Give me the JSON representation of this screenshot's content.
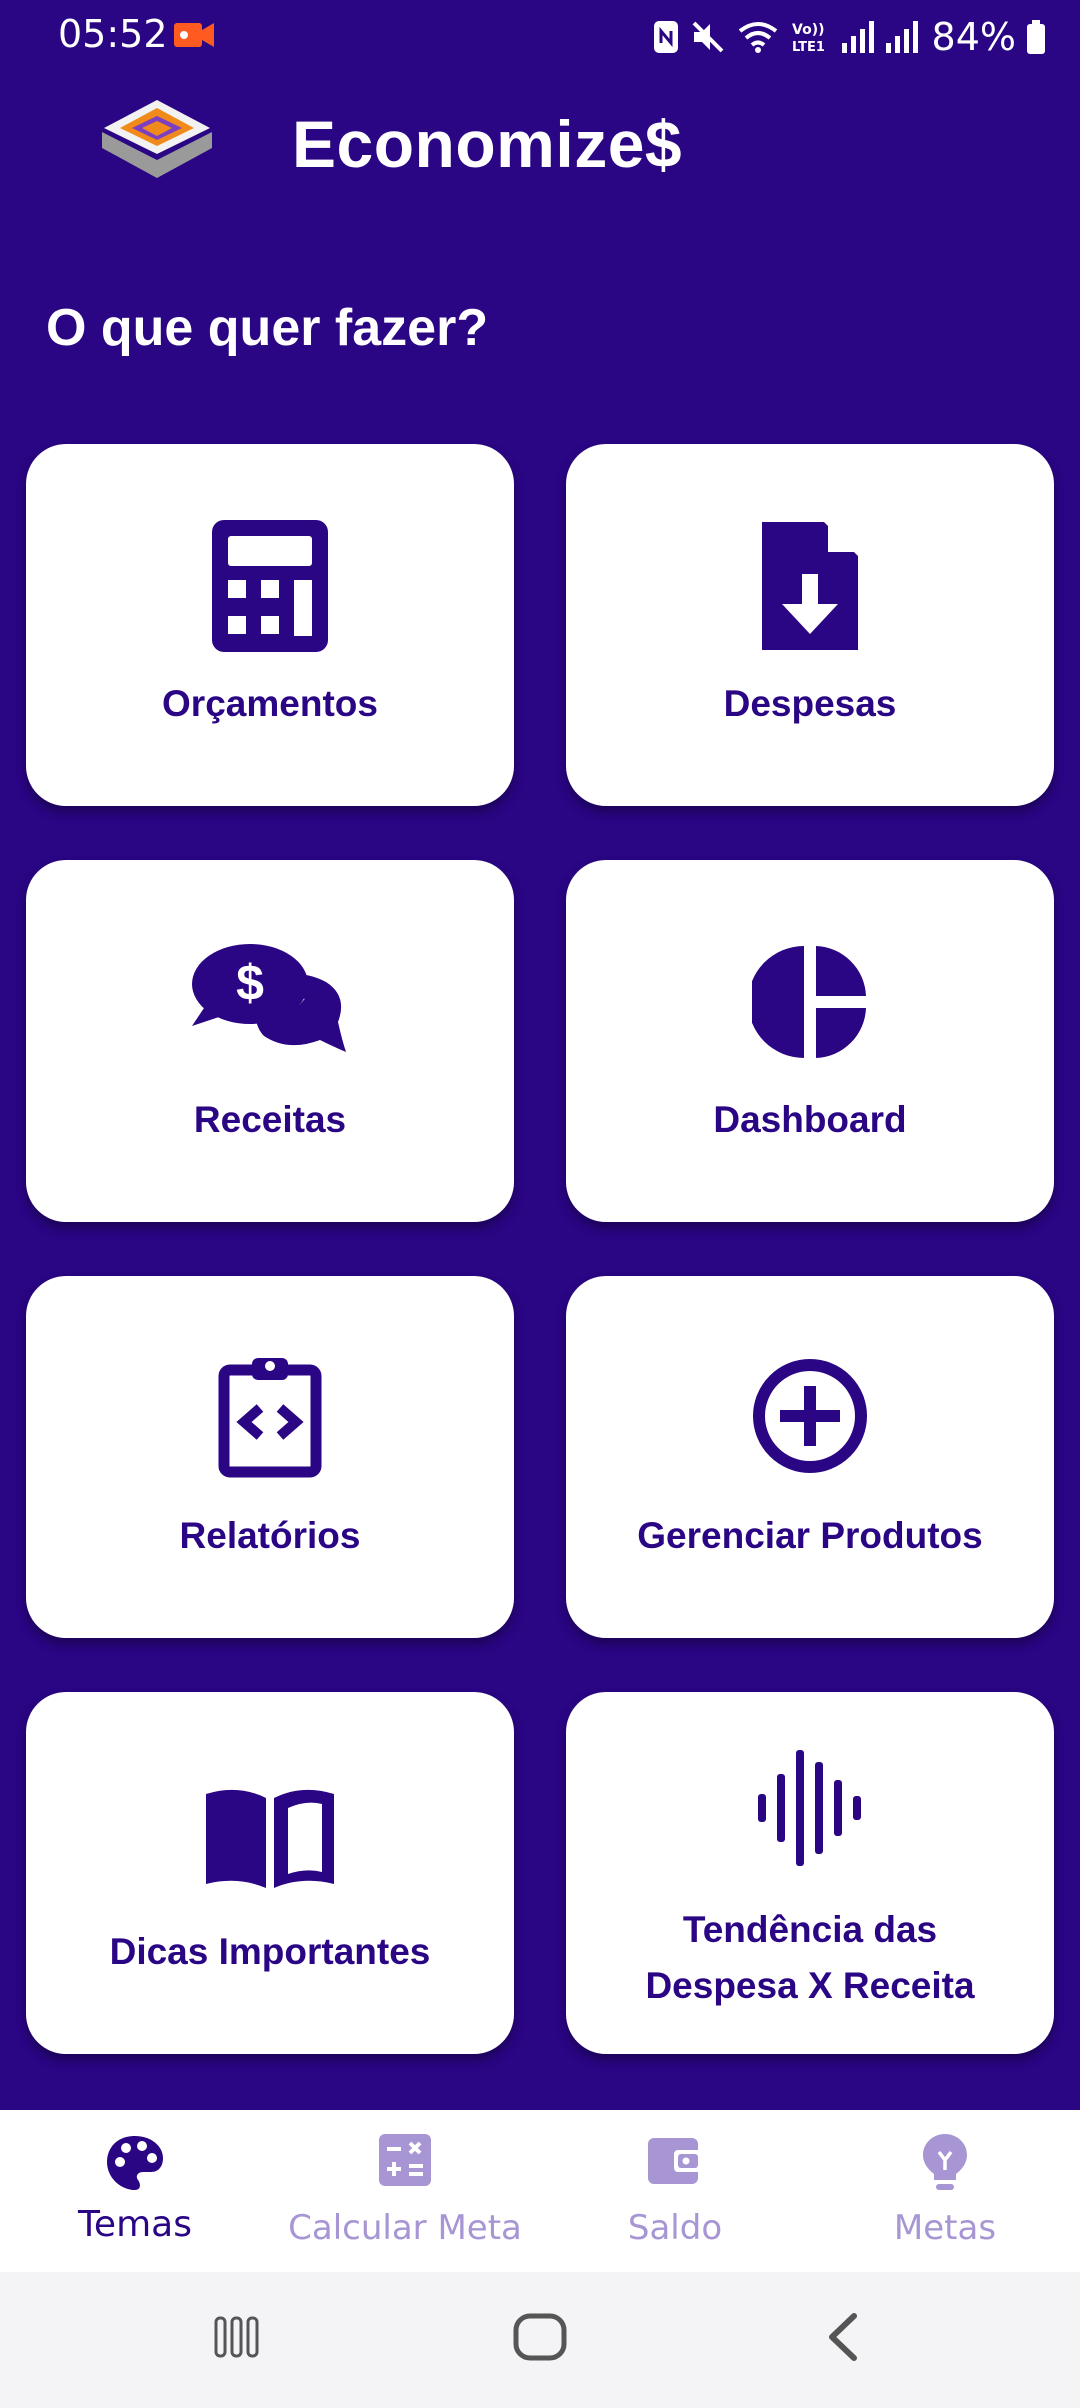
{
  "status_bar": {
    "time": "05:52",
    "battery": "84%",
    "icons": [
      "video-record-icon",
      "nfc-icon",
      "mute-icon",
      "wifi-icon",
      "volte-icon",
      "signal-icon",
      "signal-icon",
      "battery-icon"
    ]
  },
  "header": {
    "title": "Economize$",
    "logo": "app-logo-icon"
  },
  "main": {
    "question": "O que quer fazer?",
    "cards": [
      {
        "label": "Orçamentos",
        "icon": "calculator-icon"
      },
      {
        "label": "Despesas",
        "icon": "file-download-icon"
      },
      {
        "label": "Receitas",
        "icon": "money-chat-icon"
      },
      {
        "label": "Dashboard",
        "icon": "pie-chart-icon"
      },
      {
        "label": "Relatórios",
        "icon": "code-clipboard-icon"
      },
      {
        "label": "Gerenciar Produtos",
        "icon": "add-circle-icon"
      },
      {
        "label": "Dicas Importantes",
        "icon": "book-icon"
      },
      {
        "label": "Tendência das",
        "label_line2": "Despesa X Receita",
        "icon": "waveform-icon"
      }
    ]
  },
  "bottom_nav": {
    "items": [
      {
        "label": "Temas",
        "icon": "palette-icon",
        "active": true
      },
      {
        "label": "Calcular Meta",
        "icon": "calculator-box-icon",
        "active": false
      },
      {
        "label": "Saldo",
        "icon": "wallet-icon",
        "active": false
      },
      {
        "label": "Metas",
        "icon": "lightbulb-icon",
        "active": false
      }
    ]
  },
  "colors": {
    "background": "#2a0584",
    "card": "#ffffff",
    "accent": "#2a0584",
    "inactive_nav": "#a796d3"
  }
}
